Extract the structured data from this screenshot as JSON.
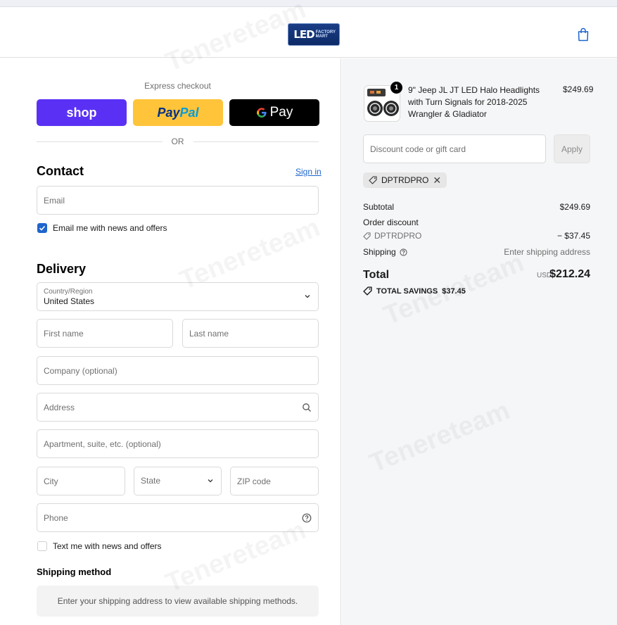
{
  "header": {
    "logo_text": "LED",
    "logo_sub": "FACTORY MART"
  },
  "express": {
    "label": "Express checkout",
    "shop": "shop",
    "paypal_a": "Pay",
    "paypal_b": "Pal",
    "gpay": "Pay",
    "or": "OR"
  },
  "contact": {
    "title": "Contact",
    "signin": "Sign in",
    "email_placeholder": "Email",
    "news_label": "Email me with news and offers"
  },
  "delivery": {
    "title": "Delivery",
    "country_label": "Country/Region",
    "country_value": "United States",
    "first_name": "First name",
    "last_name": "Last name",
    "company": "Company (optional)",
    "address": "Address",
    "apartment": "Apartment, suite, etc. (optional)",
    "city": "City",
    "state": "State",
    "zip": "ZIP code",
    "phone": "Phone",
    "text_news": "Text me with news and offers"
  },
  "shipping": {
    "title": "Shipping method",
    "message": "Enter your shipping address to view available shipping methods."
  },
  "order": {
    "qty": "1",
    "item_name": "9\" Jeep JL JT LED Halo Headlights with Turn Signals for 2018-2025 Wrangler & Gladiator",
    "item_price": "$249.69",
    "discount_placeholder": "Discount code or gift card",
    "apply": "Apply",
    "code": "DPTRDPRO",
    "subtotal_label": "Subtotal",
    "subtotal_value": "$249.69",
    "order_discount_label": "Order discount",
    "discount_code": "DPTRDPRO",
    "discount_value": "− $37.45",
    "shipping_label": "Shipping",
    "shipping_value": "Enter shipping address",
    "total_label": "Total",
    "currency": "USD",
    "total_value": "$212.24",
    "savings_label": "TOTAL SAVINGS",
    "savings_value": "$37.45"
  },
  "colors": {
    "shop": "#5a31f4",
    "paypal": "#ffc439",
    "link": "#1f65cc",
    "checkbox": "#1f65cc"
  }
}
